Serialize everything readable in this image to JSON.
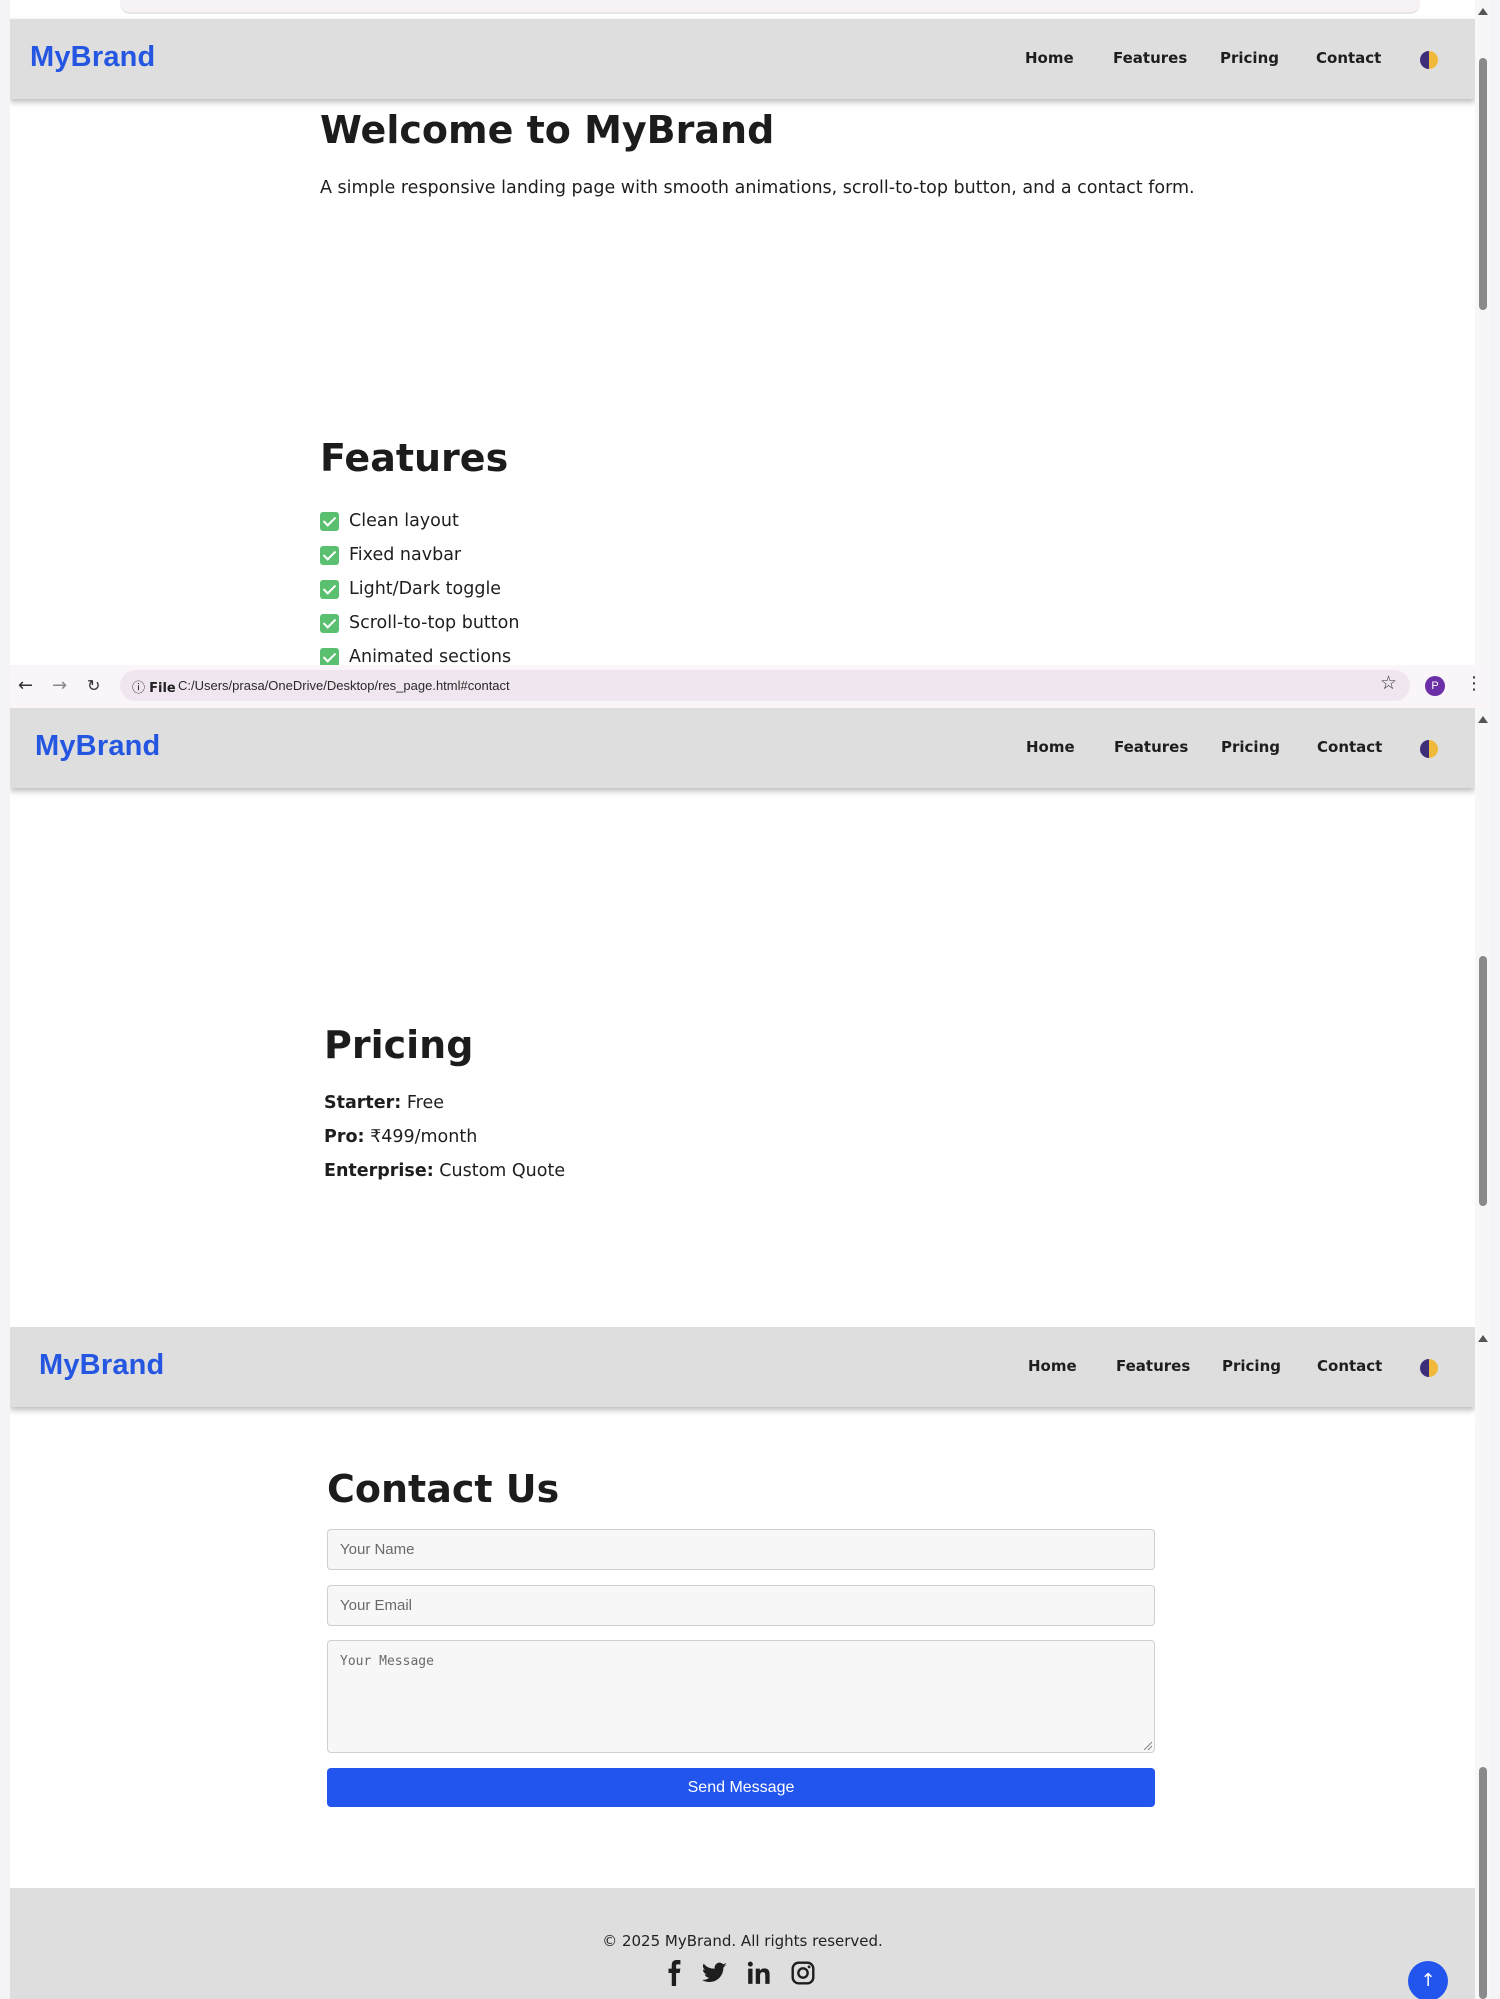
{
  "brand": "MyBrand",
  "nav": {
    "links": [
      "Home",
      "Features",
      "Pricing",
      "Contact"
    ],
    "theme_toggle_icon": "half-moon-theme-icon"
  },
  "hero": {
    "title": "Welcome to MyBrand",
    "subtitle": "A simple responsive landing page with smooth animations, scroll-to-top button, and a contact form."
  },
  "features": {
    "title": "Features",
    "items": [
      "Clean layout",
      "Fixed navbar",
      "Light/Dark toggle",
      "Scroll-to-top button",
      "Animated sections"
    ]
  },
  "browser": {
    "info_label": "File",
    "url": "C:/Users/prasa/OneDrive/Desktop/res_page.html#contact",
    "profile_initial": "P"
  },
  "pricing": {
    "title": "Pricing",
    "plans": [
      {
        "name": "Starter:",
        "price": "Free"
      },
      {
        "name": "Pro:",
        "price": "₹499/month"
      },
      {
        "name": "Enterprise:",
        "price": "Custom Quote"
      }
    ]
  },
  "contact": {
    "title": "Contact Us",
    "name_placeholder": "Your Name",
    "email_placeholder": "Your Email",
    "message_placeholder": "Your Message",
    "submit_label": "Send Message"
  },
  "footer": {
    "copyright": "© 2025 MyBrand. All rights reserved.",
    "social_icons": [
      "facebook-icon",
      "twitter-icon",
      "linkedin-icon",
      "instagram-icon"
    ],
    "scroll_top_label": "↑"
  },
  "colors": {
    "brand": "#2456e2",
    "primary_button": "#2255ee",
    "navbar_bg": "#dedede",
    "check_green": "#5bbf70"
  }
}
